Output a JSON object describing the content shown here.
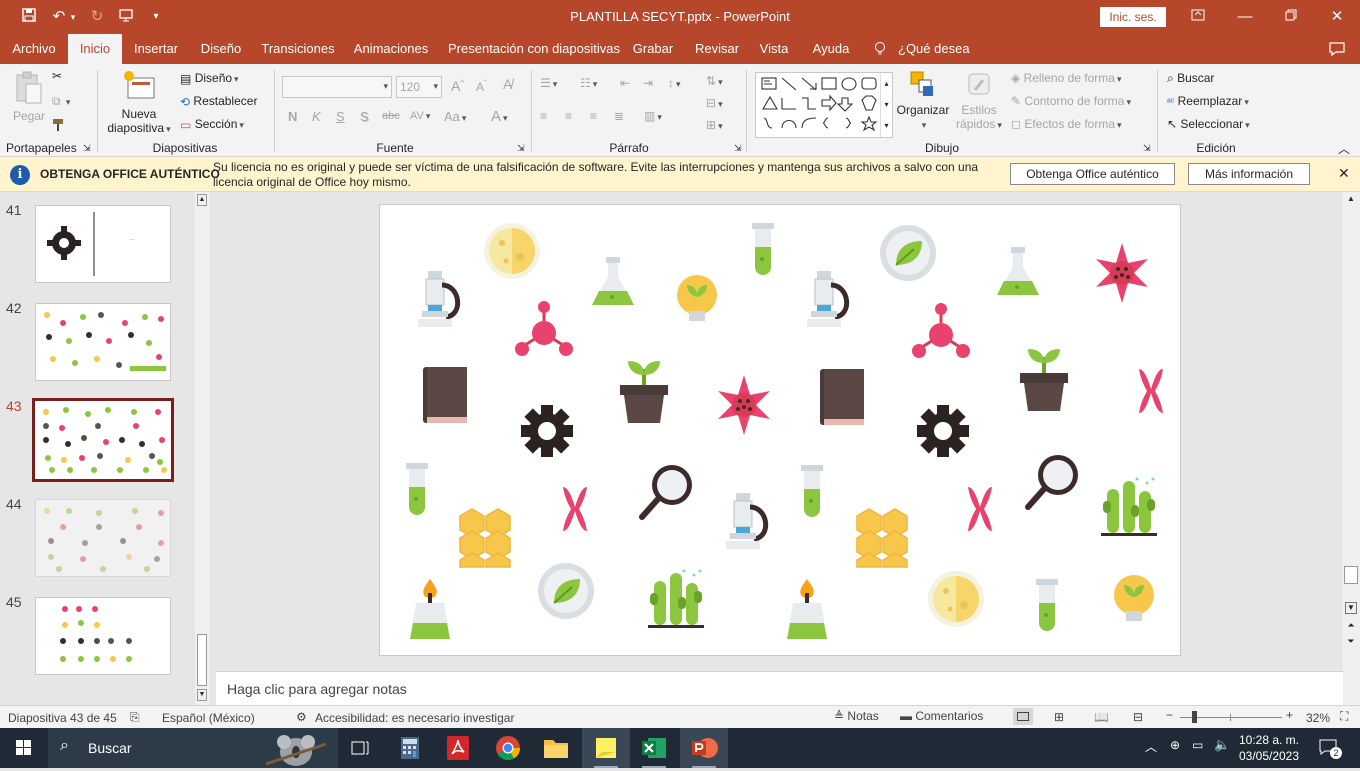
{
  "window": {
    "title": "PLANTILLA SECYT.pptx  -  PowerPoint",
    "signin": "Inic. ses."
  },
  "tabs": [
    "Archivo",
    "Inicio",
    "Insertar",
    "Diseño",
    "Transiciones",
    "Animaciones",
    "Presentación con diapositivas",
    "Grabar",
    "Revisar",
    "Vista",
    "Ayuda"
  ],
  "tell_me": "¿Qué desea hacer?",
  "ribbon": {
    "clipboard": {
      "paste": "Pegar",
      "label": "Portapapeles"
    },
    "slides": {
      "new_slide_1": "Nueva",
      "new_slide_2": "diapositiva",
      "layout": "Diseño",
      "reset": "Restablecer",
      "section": "Sección",
      "label": "Diapositivas"
    },
    "font": {
      "size": "120",
      "bold": "N",
      "italic": "K",
      "underline": "S",
      "shadow": "S",
      "strike": "abc",
      "spacing": "AV",
      "case": "Aa",
      "color": "A",
      "grow": "A",
      "shrink": "A",
      "label": "Fuente"
    },
    "paragraph": {
      "label": "Párrafo"
    },
    "drawing": {
      "arrange": "Organizar",
      "styles_1": "Estilos",
      "styles_2": "rápidos",
      "fill": "Relleno de forma",
      "outline": "Contorno de forma",
      "effects": "Efectos de forma",
      "label": "Dibujo"
    },
    "editing": {
      "find": "Buscar",
      "replace": "Reemplazar",
      "select": "Seleccionar",
      "label": "Edición"
    }
  },
  "infobar": {
    "heading": "OBTENGA OFFICE AUTÉNTICO",
    "message_1": "Su licencia no es original y puede ser víctima de una falsificación de software. Evite las interrupciones y mantenga sus archivos a salvo con una",
    "message_2": "licencia original de Office hoy mismo.",
    "button_get": "Obtenga Office auténtico",
    "button_more": "Más información"
  },
  "slides_panel": [
    {
      "number": "41",
      "selected": false
    },
    {
      "number": "42",
      "selected": false
    },
    {
      "number": "43",
      "selected": true
    },
    {
      "number": "44",
      "selected": false
    },
    {
      "number": "45",
      "selected": false
    }
  ],
  "slide41_text": "...",
  "notes_placeholder": "Haga clic para agregar notas",
  "status": {
    "slide": "Diapositiva 43 de 45",
    "language": "Español (México)",
    "accessibility": "Accesibilidad: es necesario investigar",
    "notes": "Notas",
    "comments": "Comentarios",
    "zoom": "32%"
  },
  "taskbar": {
    "search": "Buscar",
    "time": "10:28 a. m.",
    "date": "03/05/2023",
    "notifications": "2"
  },
  "colors": {
    "accent": "#b7472a",
    "infobar": "#fff4ce",
    "green": "#8cc63f",
    "pink": "#e8436e",
    "dark": "#3d2b2b",
    "yellow": "#f7c74b"
  },
  "slide_icons": [
    "microscope-icon",
    "moon-icon",
    "molecule-icon",
    "flask-icon",
    "lightbulb-icon",
    "test-tube-icon",
    "leaf-petri-icon",
    "virus-icon",
    "book-icon",
    "gear-icon",
    "plant-pot-icon",
    "magnifier-icon",
    "chromosome-icon",
    "honeycomb-icon",
    "cactus-icon",
    "burner-icon"
  ]
}
